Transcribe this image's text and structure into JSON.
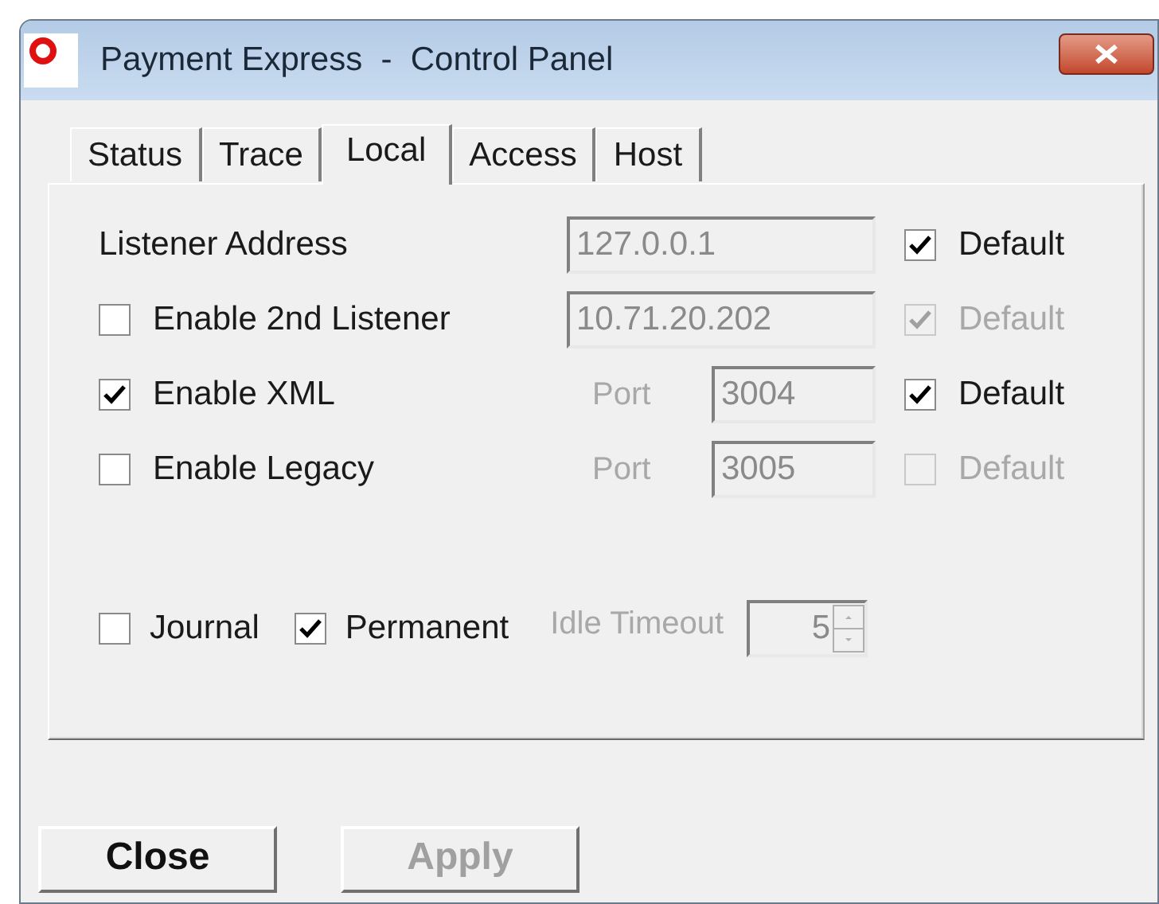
{
  "window": {
    "title": "Payment Express  -  Control Panel"
  },
  "tabs": [
    {
      "label": "Status",
      "selected": false
    },
    {
      "label": "Trace",
      "selected": false
    },
    {
      "label": "Local",
      "selected": true
    },
    {
      "label": "Access",
      "selected": false
    },
    {
      "label": "Host",
      "selected": false
    }
  ],
  "rows": [
    {
      "kind": "label",
      "label": "Listener Address",
      "field": {
        "value": "127.0.0.1",
        "disabled": true
      },
      "default": {
        "label": "Default",
        "checked": true,
        "disabled": false
      }
    },
    {
      "kind": "checkbox",
      "label": "Enable 2nd Listener",
      "checked": false,
      "field": {
        "value": "10.71.20.202",
        "disabled": true
      },
      "default": {
        "label": "Default",
        "checked": true,
        "disabled": true
      }
    },
    {
      "kind": "checkbox",
      "label": "Enable XML",
      "checked": true,
      "field": {
        "port_label": "Port",
        "value": "3004",
        "disabled": true
      },
      "default": {
        "label": "Default",
        "checked": true,
        "disabled": false
      }
    },
    {
      "kind": "checkbox",
      "label": "Enable Legacy",
      "checked": false,
      "field": {
        "port_label": "Port",
        "value": "3005",
        "disabled": true
      },
      "default": {
        "label": "Default",
        "checked": false,
        "disabled": true
      }
    }
  ],
  "journal": {
    "label": "Journal",
    "checked": false
  },
  "permanent": {
    "label": "Permanent",
    "checked": true
  },
  "idle_timeout": {
    "label": "Idle Timeout",
    "value": "5",
    "disabled": true
  },
  "buttons": [
    {
      "label": "Close",
      "disabled": false
    },
    {
      "label": "Apply",
      "disabled": true
    }
  ]
}
